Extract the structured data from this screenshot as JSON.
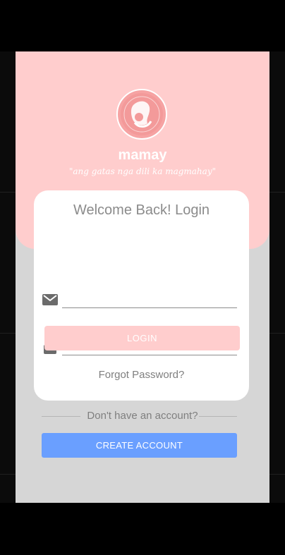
{
  "app": {
    "name": "mamay",
    "tagline": "\"ang gatas nga dili ka magmahay\""
  },
  "card": {
    "title": "Welcome Back! Login"
  },
  "form": {
    "email_icon": "email-icon",
    "password_icon": "lock-icon",
    "login_label": "LOGIN",
    "forgot_label": "Forgot Password?"
  },
  "signup": {
    "prompt": "Don't have an account?",
    "create_label": "CREATE ACCOUNT"
  },
  "colors": {
    "header": "#ffcdcd",
    "primary": "#6a9fff",
    "background": "#d6d6d6"
  }
}
